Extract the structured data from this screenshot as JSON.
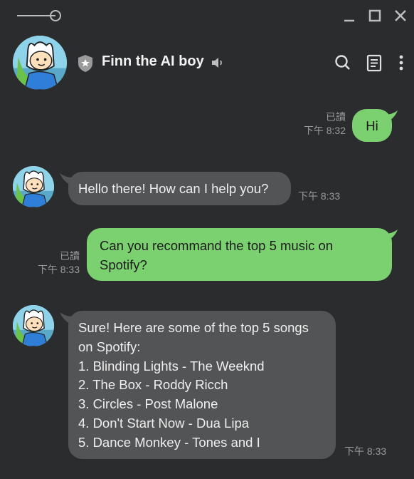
{
  "window": {
    "controls": [
      "minimize-icon",
      "maximize-icon",
      "close-icon"
    ]
  },
  "header": {
    "contact_name": "Finn the AI boy",
    "icons": [
      "shield-icon",
      "speaker-icon",
      "search-icon",
      "notes-icon",
      "more-icon"
    ]
  },
  "colors": {
    "background": "#2b2c2e",
    "outgoing_bubble": "#7bd06f",
    "incoming_bubble": "#535456"
  },
  "messages": [
    {
      "direction": "out",
      "text_lines": [
        "Hi"
      ],
      "read": "已讀",
      "time": "下午 8:32"
    },
    {
      "direction": "in",
      "text_lines": [
        "Hello there! How can I help you?"
      ],
      "time": "下午 8:33"
    },
    {
      "direction": "out",
      "text_lines": [
        "Can you recommand the top 5 music on",
        "Spotify?"
      ],
      "read": "已讀",
      "time": "下午 8:33"
    },
    {
      "direction": "in",
      "text_lines": [
        "Sure! Here are some of the top 5 songs",
        "on Spotify:",
        "1. Blinding Lights - The Weeknd",
        "2. The Box - Roddy Ricch",
        "3. Circles - Post Malone",
        "4. Don't Start Now - Dua Lipa",
        "5. Dance Monkey - Tones and I"
      ],
      "time": "下午 8:33"
    }
  ]
}
